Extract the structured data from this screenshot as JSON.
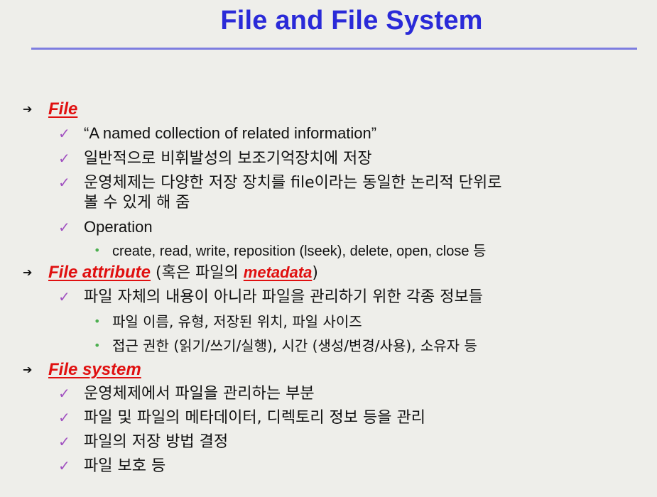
{
  "slide": {
    "title": "File and File System",
    "accent_color": "#2a2ad8",
    "heading_color": "#e01010",
    "check_color": "#a050c0",
    "dot_color": "#4caf50"
  },
  "file": {
    "heading": "File",
    "items": [
      "“A named collection of related information”",
      "일반적으로 비휘발성의 보조기억장치에 저장",
      "운영체제는 다양한 저장 장치를 file이라는 동일한 논리적 단위로",
      "볼 수 있게 해 줌",
      "Operation"
    ],
    "operation_sub": "create, read, write, reposition (lseek), delete, open, close 등"
  },
  "attribute": {
    "heading": "File attribute",
    "paren_open": " (혹은 파일의 ",
    "meta_word": "metadata",
    "paren_close": ")",
    "item": "파일 자체의 내용이 아니라 파일을 관리하기 위한 각종 정보들",
    "subs": [
      "파일 이름, 유형, 저장된 위치, 파일 사이즈",
      "접근 권한 (읽기/쓰기/실행), 시간 (생성/변경/사용),  소유자 등"
    ]
  },
  "filesystem": {
    "heading": "File system",
    "items": [
      "운영체제에서 파일을 관리하는 부분",
      "파일 및 파일의 메타데이터, 디렉토리 정보 등을 관리",
      "파일의 저장 방법 결정",
      "파일 보호 등"
    ]
  },
  "markers": {
    "arrow": "➔",
    "check": "✓",
    "dot": "•"
  }
}
